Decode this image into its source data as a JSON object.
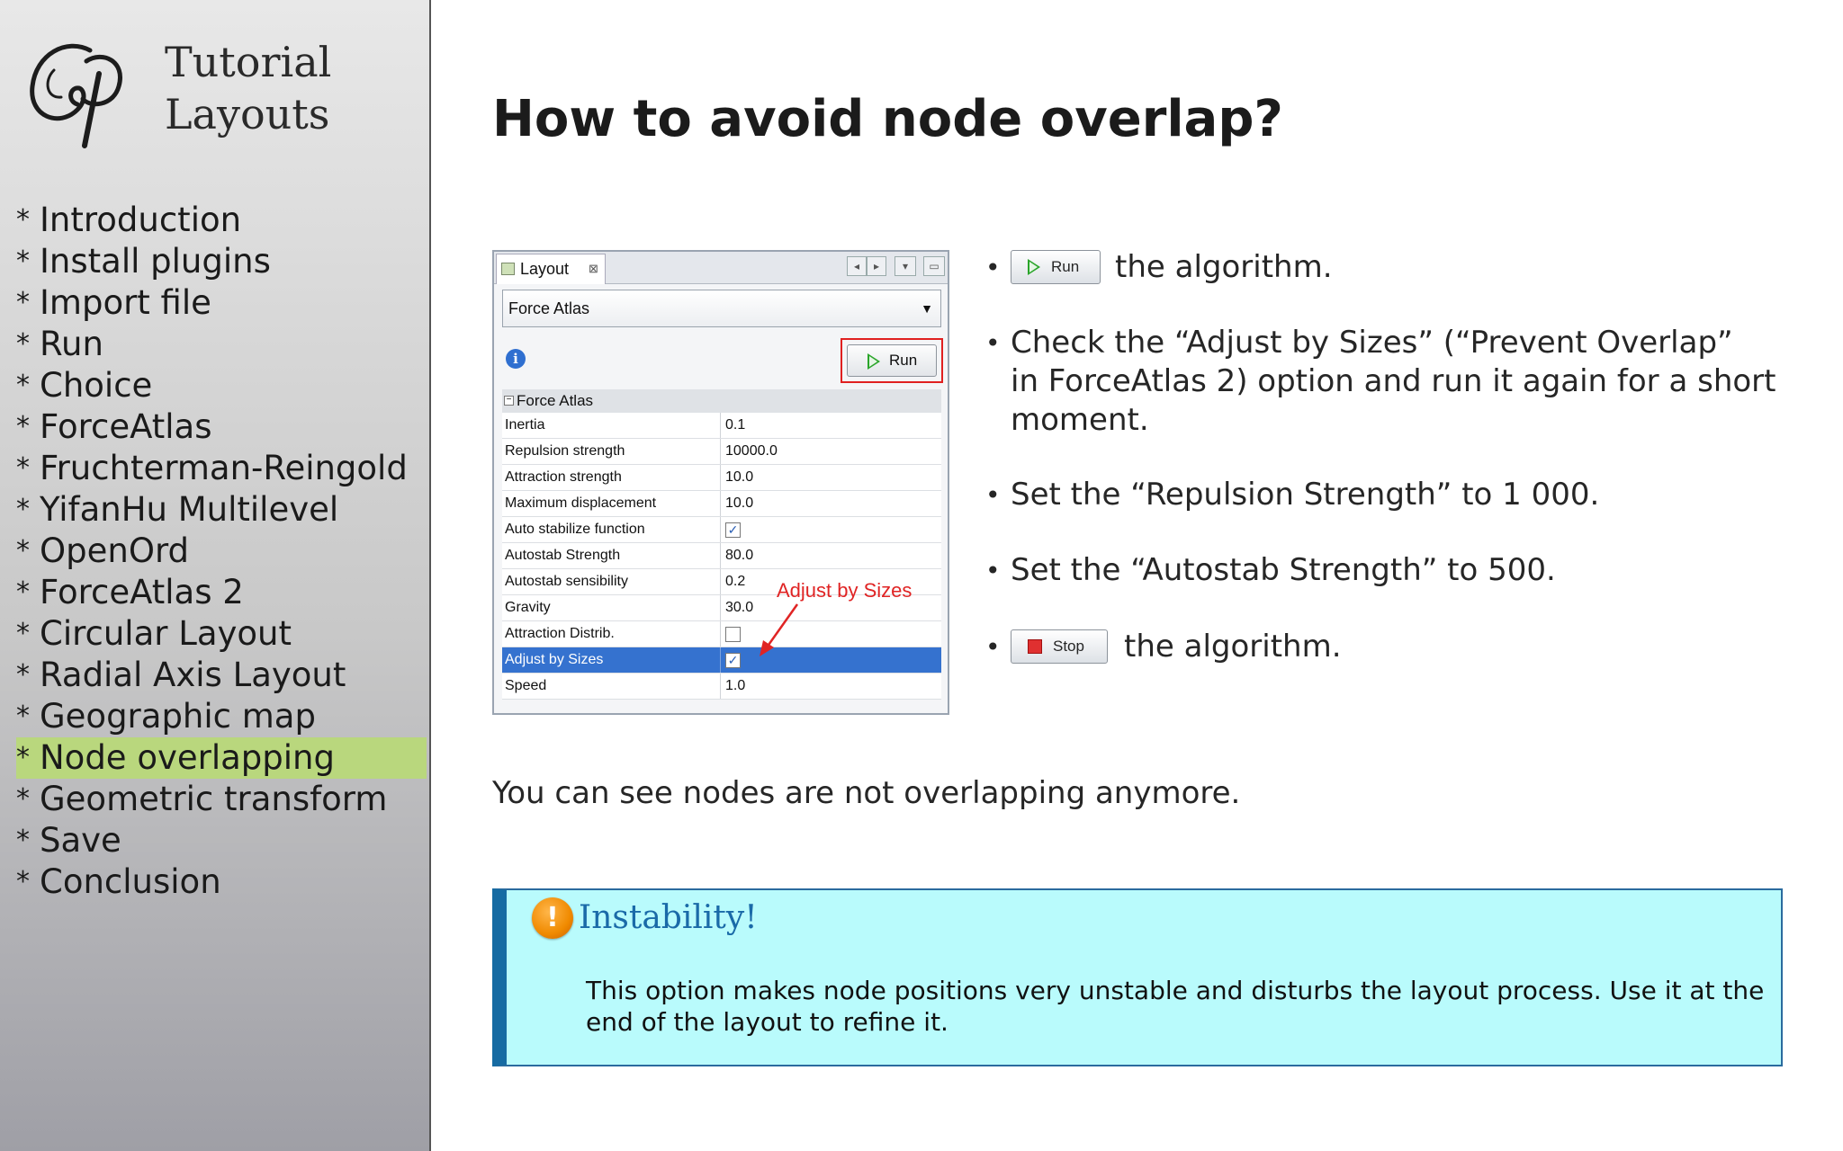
{
  "sidebar": {
    "logo_title_line1": "Tutorial",
    "logo_title_line2": "Layouts",
    "bullet_char": "*",
    "items": [
      {
        "label": "Introduction",
        "active": false
      },
      {
        "label": "Install plugins",
        "active": false
      },
      {
        "label": "Import file",
        "active": false
      },
      {
        "label": "Run",
        "active": false
      },
      {
        "label": "Choice",
        "active": false
      },
      {
        "label": "ForceAtlas",
        "active": false
      },
      {
        "label": "Fruchterman-Reingold",
        "active": false
      },
      {
        "label": "YifanHu Multilevel",
        "active": false
      },
      {
        "label": "OpenOrd",
        "active": false
      },
      {
        "label": "ForceAtlas 2",
        "active": false
      },
      {
        "label": "Circular Layout",
        "active": false
      },
      {
        "label": "Radial Axis Layout",
        "active": false
      },
      {
        "label": "Geographic map",
        "active": false
      },
      {
        "label": "Node overlapping",
        "active": true
      },
      {
        "label": "Geometric transform",
        "active": false
      },
      {
        "label": "Save",
        "active": false
      },
      {
        "label": "Conclusion",
        "active": false
      }
    ],
    "active_color": "#b9d77d"
  },
  "main": {
    "title": "How to avoid node overlap?",
    "summary": "You can see nodes are not overlapping anymore."
  },
  "panel": {
    "tab_label": "Layout",
    "tab_close": "⊠",
    "algorithm": "Force Atlas",
    "info_glyph": "i",
    "run_label": "Run",
    "group_label": "Force Atlas",
    "rows": [
      {
        "name": "Inertia",
        "value": "0.1",
        "checkbox": false,
        "selected": false
      },
      {
        "name": "Repulsion strength",
        "value": "10000.0",
        "checkbox": false,
        "selected": false
      },
      {
        "name": "Attraction strength",
        "value": "10.0",
        "checkbox": false,
        "selected": false
      },
      {
        "name": "Maximum displacement",
        "value": "10.0",
        "checkbox": false,
        "selected": false
      },
      {
        "name": "Auto stabilize function",
        "value": "",
        "checkbox": true,
        "checked": true,
        "selected": false
      },
      {
        "name": "Autostab Strength",
        "value": "80.0",
        "checkbox": false,
        "selected": false
      },
      {
        "name": "Autostab sensibility",
        "value": "0.2",
        "checkbox": false,
        "selected": false
      },
      {
        "name": "Gravity",
        "value": "30.0",
        "checkbox": false,
        "selected": false
      },
      {
        "name": "Attraction Distrib.",
        "value": "",
        "checkbox": true,
        "checked": false,
        "selected": false
      },
      {
        "name": "Adjust by Sizes",
        "value": "",
        "checkbox": true,
        "checked": true,
        "selected": true
      },
      {
        "name": "Speed",
        "value": "1.0",
        "checkbox": false,
        "selected": false
      }
    ],
    "annotation": "Adjust by Sizes",
    "annotation_color": "#e02424",
    "highlight_color": "#e02020",
    "selected_row_color": "#3572cf"
  },
  "bullets": {
    "dot": "•",
    "run_button": "Run",
    "run_text": "the algorithm.",
    "check_line1": "Check the “Adjust by Sizes” (“Prevent Overlap”",
    "check_line2": "in ForceAtlas 2) option and run it again for a short",
    "check_line3": "moment.",
    "repulsion": "Set the “Repulsion Strength” to 1 000.",
    "autostab": "Set the “Autostab Strength” to 500.",
    "stop_button": "Stop",
    "stop_text": "the algorithm."
  },
  "warning": {
    "icon_glyph": "!",
    "title": "Instability!",
    "body": "This option makes node positions very unstable and disturbs the layout process. Use it at the end of the layout to refine it.",
    "background": "#b9fbfc",
    "accent": "#166ba3"
  }
}
